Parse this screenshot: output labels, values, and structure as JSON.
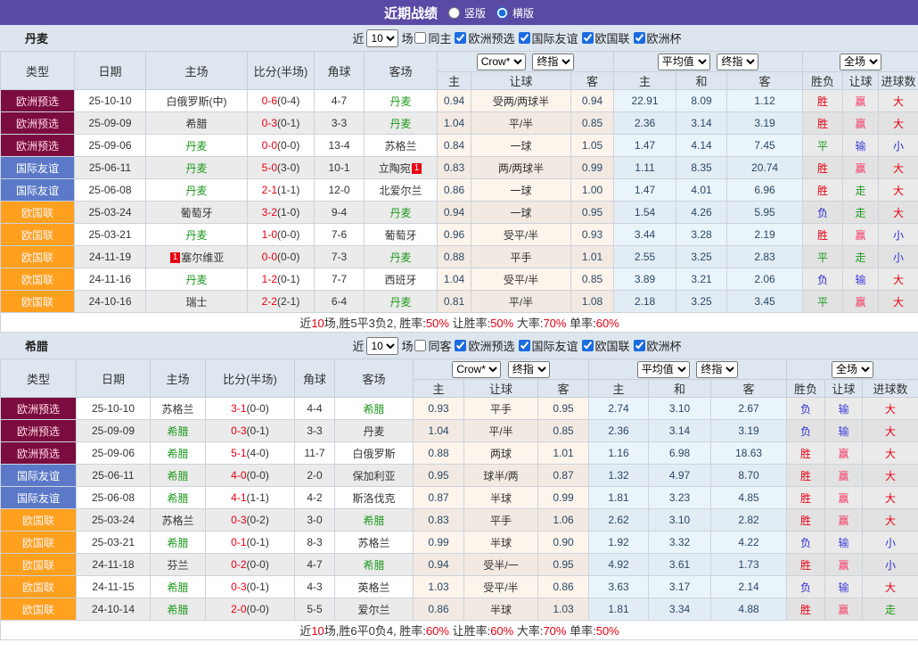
{
  "titlebar": {
    "title": "近期战绩",
    "layout_options": [
      {
        "label": "竖版",
        "selected": false
      },
      {
        "label": "横版",
        "selected": true
      }
    ]
  },
  "filters": {
    "near_label": "近",
    "count_value": "10",
    "games_label": "场",
    "competitions": [
      "欧洲预选",
      "国际友谊",
      "欧国联",
      "欧洲杯"
    ]
  },
  "columns": {
    "type": "类型",
    "date": "日期",
    "home": "主场",
    "score": "比分(半场)",
    "corners": "角球",
    "away": "客场",
    "group1_select1": "Crow*",
    "group1_select2": "终指",
    "group2_select1": "平均值",
    "group2_select2": "终指",
    "group3_select1": "全场",
    "sub": [
      "主",
      "让球",
      "客",
      "主",
      "和",
      "客",
      "胜负",
      "让球",
      "进球数"
    ]
  },
  "colors": {
    "type_badges": {
      "欧洲预选": {
        "bg": "#7b0c3f",
        "fg": "#ffd9e3"
      },
      "国际友谊": {
        "bg": "#5b79c8",
        "fg": "#ffffff"
      },
      "欧国联": {
        "bg": "#ffa01e",
        "fg": "#fff3f3"
      }
    },
    "results": {
      "胜": "#e60012",
      "平": "#1a9a1a",
      "负": "#2d2dd0",
      "赢": "#f43b64",
      "输": "#3d3dd8",
      "走": "#1a9a1a",
      "大": "#e60012",
      "小": "#2d2dd0"
    },
    "focus_team": "#1f9a1f",
    "score_red": "#e60012"
  },
  "sections": [
    {
      "team": "丹麦",
      "same_label": "同主",
      "rows": [
        {
          "type": "欧洲预选",
          "date": "25-10-10",
          "home": "白俄罗斯(中)",
          "home_focus": false,
          "score": "0-6",
          "half": "(0-4)",
          "corners": "4-7",
          "away": "丹麦",
          "away_focus": true,
          "crow": [
            "0.94",
            "受两/两球半",
            "0.94"
          ],
          "avg": [
            "22.91",
            "8.09",
            "1.12"
          ],
          "result": [
            "胜",
            "赢",
            "大"
          ]
        },
        {
          "type": "欧洲预选",
          "date": "25-09-09",
          "home": "希腊",
          "home_focus": false,
          "score": "0-3",
          "half": "(0-1)",
          "corners": "3-3",
          "away": "丹麦",
          "away_focus": true,
          "crow": [
            "1.04",
            "平/半",
            "0.85"
          ],
          "avg": [
            "2.36",
            "3.14",
            "3.19"
          ],
          "result": [
            "胜",
            "赢",
            "大"
          ]
        },
        {
          "type": "欧洲预选",
          "date": "25-09-06",
          "home": "丹麦",
          "home_focus": true,
          "score": "0-0",
          "half": "(0-0)",
          "corners": "13-4",
          "away": "苏格兰",
          "away_focus": false,
          "crow": [
            "0.84",
            "一球",
            "1.05"
          ],
          "avg": [
            "1.47",
            "4.14",
            "7.45"
          ],
          "result": [
            "平",
            "输",
            "小"
          ]
        },
        {
          "type": "国际友谊",
          "date": "25-06-11",
          "home": "丹麦",
          "home_focus": true,
          "score": "5-0",
          "half": "(3-0)",
          "corners": "10-1",
          "away": "立陶宛",
          "away_focus": false,
          "away_badge": "1",
          "away_badge_pos": "after",
          "crow": [
            "0.83",
            "两/两球半",
            "0.99"
          ],
          "avg": [
            "1.11",
            "8.35",
            "20.74"
          ],
          "result": [
            "胜",
            "赢",
            "大"
          ]
        },
        {
          "type": "国际友谊",
          "date": "25-06-08",
          "home": "丹麦",
          "home_focus": true,
          "score": "2-1",
          "half": "(1-1)",
          "corners": "12-0",
          "away": "北爱尔兰",
          "away_focus": false,
          "crow": [
            "0.86",
            "一球",
            "1.00"
          ],
          "avg": [
            "1.47",
            "4.01",
            "6.96"
          ],
          "result": [
            "胜",
            "走",
            "大"
          ]
        },
        {
          "type": "欧国联",
          "date": "25-03-24",
          "home": "葡萄牙",
          "home_focus": false,
          "score": "3-2",
          "half": "(1-0)",
          "corners": "9-4",
          "away": "丹麦",
          "away_focus": true,
          "crow": [
            "0.94",
            "一球",
            "0.95"
          ],
          "avg": [
            "1.54",
            "4.26",
            "5.95"
          ],
          "result": [
            "负",
            "走",
            "大"
          ]
        },
        {
          "type": "欧国联",
          "date": "25-03-21",
          "home": "丹麦",
          "home_focus": true,
          "score": "1-0",
          "half": "(0-0)",
          "corners": "7-6",
          "away": "葡萄牙",
          "away_focus": false,
          "crow": [
            "0.96",
            "受平/半",
            "0.93"
          ],
          "avg": [
            "3.44",
            "3.28",
            "2.19"
          ],
          "result": [
            "胜",
            "赢",
            "小"
          ]
        },
        {
          "type": "欧国联",
          "date": "24-11-19",
          "home": "塞尔维亚",
          "home_focus": false,
          "home_badge": "1",
          "home_badge_pos": "before",
          "score": "0-0",
          "half": "(0-0)",
          "corners": "7-3",
          "away": "丹麦",
          "away_focus": true,
          "crow": [
            "0.88",
            "平手",
            "1.01"
          ],
          "avg": [
            "2.55",
            "3.25",
            "2.83"
          ],
          "result": [
            "平",
            "走",
            "小"
          ]
        },
        {
          "type": "欧国联",
          "date": "24-11-16",
          "home": "丹麦",
          "home_focus": true,
          "score": "1-2",
          "half": "(0-1)",
          "corners": "7-7",
          "away": "西班牙",
          "away_focus": false,
          "crow": [
            "1.04",
            "受平/半",
            "0.85"
          ],
          "avg": [
            "3.89",
            "3.21",
            "2.06"
          ],
          "result": [
            "负",
            "输",
            "大"
          ]
        },
        {
          "type": "欧国联",
          "date": "24-10-16",
          "home": "瑞士",
          "home_focus": false,
          "score": "2-2",
          "half": "(2-1)",
          "corners": "6-4",
          "away": "丹麦",
          "away_focus": true,
          "crow": [
            "0.81",
            "平/半",
            "1.08"
          ],
          "avg": [
            "2.18",
            "3.25",
            "3.45"
          ],
          "result": [
            "平",
            "赢",
            "大"
          ]
        }
      ],
      "summary": [
        {
          "t": "近"
        },
        {
          "t": "10",
          "red": true
        },
        {
          "t": "场,胜5平3负2, 胜率:"
        },
        {
          "t": "50%",
          "red": true
        },
        {
          "t": " 让胜率:"
        },
        {
          "t": "50%",
          "red": true
        },
        {
          "t": " 大率:"
        },
        {
          "t": "70%",
          "red": true
        },
        {
          "t": " 单率:"
        },
        {
          "t": "60%",
          "red": true
        }
      ]
    },
    {
      "team": "希腊",
      "same_label": "同客",
      "rows": [
        {
          "type": "欧洲预选",
          "date": "25-10-10",
          "home": "苏格兰",
          "home_focus": false,
          "score": "3-1",
          "half": "(0-0)",
          "corners": "4-4",
          "away": "希腊",
          "away_focus": true,
          "crow": [
            "0.93",
            "平手",
            "0.95"
          ],
          "avg": [
            "2.74",
            "3.10",
            "2.67"
          ],
          "result": [
            "负",
            "输",
            "大"
          ]
        },
        {
          "type": "欧洲预选",
          "date": "25-09-09",
          "home": "希腊",
          "home_focus": true,
          "score": "0-3",
          "half": "(0-1)",
          "corners": "3-3",
          "away": "丹麦",
          "away_focus": false,
          "crow": [
            "1.04",
            "平/半",
            "0.85"
          ],
          "avg": [
            "2.36",
            "3.14",
            "3.19"
          ],
          "result": [
            "负",
            "输",
            "大"
          ]
        },
        {
          "type": "欧洲预选",
          "date": "25-09-06",
          "home": "希腊",
          "home_focus": true,
          "score": "5-1",
          "half": "(4-0)",
          "corners": "11-7",
          "away": "白俄罗斯",
          "away_focus": false,
          "crow": [
            "0.88",
            "两球",
            "1.01"
          ],
          "avg": [
            "1.16",
            "6.98",
            "18.63"
          ],
          "result": [
            "胜",
            "赢",
            "大"
          ]
        },
        {
          "type": "国际友谊",
          "date": "25-06-11",
          "home": "希腊",
          "home_focus": true,
          "score": "4-0",
          "half": "(0-0)",
          "corners": "2-0",
          "away": "保加利亚",
          "away_focus": false,
          "crow": [
            "0.95",
            "球半/两",
            "0.87"
          ],
          "avg": [
            "1.32",
            "4.97",
            "8.70"
          ],
          "result": [
            "胜",
            "赢",
            "大"
          ]
        },
        {
          "type": "国际友谊",
          "date": "25-06-08",
          "home": "希腊",
          "home_focus": true,
          "score": "4-1",
          "half": "(1-1)",
          "corners": "4-2",
          "away": "斯洛伐克",
          "away_focus": false,
          "crow": [
            "0.87",
            "半球",
            "0.99"
          ],
          "avg": [
            "1.81",
            "3.23",
            "4.85"
          ],
          "result": [
            "胜",
            "赢",
            "大"
          ]
        },
        {
          "type": "欧国联",
          "date": "25-03-24",
          "home": "苏格兰",
          "home_focus": false,
          "score": "0-3",
          "half": "(0-2)",
          "corners": "3-0",
          "away": "希腊",
          "away_focus": true,
          "crow": [
            "0.83",
            "平手",
            "1.06"
          ],
          "avg": [
            "2.62",
            "3.10",
            "2.82"
          ],
          "result": [
            "胜",
            "赢",
            "大"
          ]
        },
        {
          "type": "欧国联",
          "date": "25-03-21",
          "home": "希腊",
          "home_focus": true,
          "score": "0-1",
          "half": "(0-1)",
          "corners": "8-3",
          "away": "苏格兰",
          "away_focus": false,
          "crow": [
            "0.99",
            "半球",
            "0.90"
          ],
          "avg": [
            "1.92",
            "3.32",
            "4.22"
          ],
          "result": [
            "负",
            "输",
            "小"
          ]
        },
        {
          "type": "欧国联",
          "date": "24-11-18",
          "home": "芬兰",
          "home_focus": false,
          "score": "0-2",
          "half": "(0-0)",
          "corners": "4-7",
          "away": "希腊",
          "away_focus": true,
          "crow": [
            "0.94",
            "受半/一",
            "0.95"
          ],
          "avg": [
            "4.92",
            "3.61",
            "1.73"
          ],
          "result": [
            "胜",
            "赢",
            "小"
          ]
        },
        {
          "type": "欧国联",
          "date": "24-11-15",
          "home": "希腊",
          "home_focus": true,
          "score": "0-3",
          "half": "(0-1)",
          "corners": "4-3",
          "away": "英格兰",
          "away_focus": false,
          "crow": [
            "1.03",
            "受平/半",
            "0.86"
          ],
          "avg": [
            "3.63",
            "3.17",
            "2.14"
          ],
          "result": [
            "负",
            "输",
            "大"
          ]
        },
        {
          "type": "欧国联",
          "date": "24-10-14",
          "home": "希腊",
          "home_focus": true,
          "score": "2-0",
          "half": "(0-0)",
          "corners": "5-5",
          "away": "爱尔兰",
          "away_focus": false,
          "crow": [
            "0.86",
            "半球",
            "1.03"
          ],
          "avg": [
            "1.81",
            "3.34",
            "4.88"
          ],
          "result": [
            "胜",
            "赢",
            "走"
          ]
        }
      ],
      "summary": [
        {
          "t": "近"
        },
        {
          "t": "10",
          "red": true
        },
        {
          "t": "场,胜6平0负4, 胜率:"
        },
        {
          "t": "60%",
          "red": true
        },
        {
          "t": " 让胜率:"
        },
        {
          "t": "60%",
          "red": true
        },
        {
          "t": " 大率:"
        },
        {
          "t": "70%",
          "red": true
        },
        {
          "t": " 单率:"
        },
        {
          "t": "50%",
          "red": true
        }
      ]
    }
  ]
}
